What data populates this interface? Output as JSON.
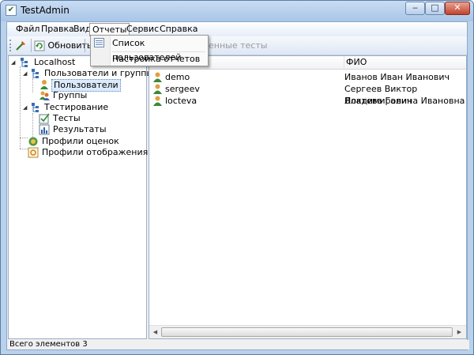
{
  "window": {
    "title": "TestAdmin",
    "min": "‒",
    "max": "□",
    "close": "✕"
  },
  "menubar": {
    "items": [
      "Файл",
      "Правка",
      "Вид",
      "Отчеты",
      "Сервис",
      "Справка"
    ],
    "active": "Отчеты"
  },
  "toolbar": {
    "refresh_label": "Обновить",
    "faded_label": "енные тесты"
  },
  "dropdown": {
    "items": [
      "Список пользователей",
      "Настройка отчетов"
    ]
  },
  "tree": {
    "root": "Localhost",
    "users_and_groups": "Пользователи и группы",
    "users": "Пользователи",
    "groups": "Группы",
    "testing": "Тестирование",
    "tests": "Тесты",
    "results": "Результаты",
    "score_profiles": "Профили оценок",
    "display_profiles": "Профили отображения"
  },
  "list": {
    "columns": [
      "",
      "ФИО"
    ],
    "rows": [
      {
        "login": "demo",
        "name": "Иванов Иван Иванович"
      },
      {
        "login": "sergeev",
        "name": "Сергеев Виктор Владимирович"
      },
      {
        "login": "locteva",
        "name": "Локтева Галина Ивановна"
      }
    ]
  },
  "status": {
    "text": "Всего элементов 3"
  },
  "colors": {
    "selection": "#dcebfc",
    "titlebar": "#b9d1ea",
    "close": "#c0432d"
  }
}
